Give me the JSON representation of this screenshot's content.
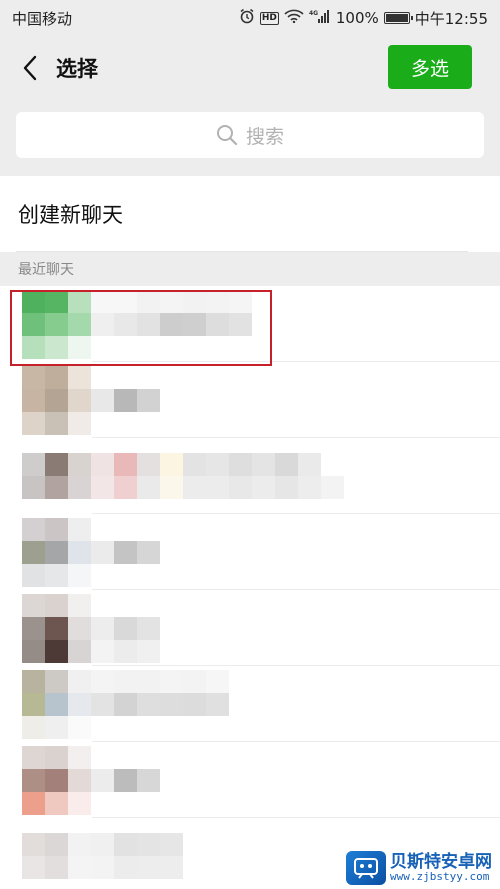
{
  "status_bar": {
    "carrier": "中国移动",
    "hd": "HD",
    "network": "4G",
    "battery": "100%",
    "time": "中午12:55",
    "icons": [
      "alarm-icon",
      "hd-icon",
      "wifi-icon",
      "signal-icon",
      "battery-icon"
    ]
  },
  "nav": {
    "back_icon": "chevron-left-icon",
    "title": "选择",
    "multi_select": "多选",
    "accent": "#1aad19"
  },
  "search": {
    "placeholder": "搜索",
    "icon": "search-icon"
  },
  "new_chat": {
    "label": "创建新聊天"
  },
  "recent": {
    "section_label": "最近聊天",
    "items": [
      {
        "mosaic": [
          [
            "#4fb05d",
            "#55b562",
            "#b8e0bd",
            "#f7f7f7",
            "#f7f7f7",
            "#f2f2f2",
            "#f4f4f4",
            "#f2f2f2",
            "#f3f3f3",
            "#f5f5f5"
          ],
          [
            "#6ec07a",
            "#86cc8f",
            "#a4d9ab",
            "#efefef",
            "#e8e8e8",
            "#e2e2e2",
            "#cdcdcd",
            "#cfcfcf",
            "#dddddd",
            "#e2e2e2"
          ],
          [
            "#b6dfbb",
            "#cbe8cf",
            "#eef7ef",
            "#ffffff",
            "#ffffff",
            "#ffffff",
            "#ffffff",
            "#ffffff",
            "#ffffff",
            "#ffffff"
          ]
        ]
      },
      {
        "mosaic": [
          [
            "#c9b7a5",
            "#bfae9c",
            "#ece3da",
            "#ffffff",
            "#ffffff",
            "#ffffff",
            "#ffffff",
            "#ffffff",
            "#ffffff",
            "#ffffff"
          ],
          [
            "#c8b4a2",
            "#b3a493",
            "#e1d6cc",
            "#e8e8e8",
            "#b8b8b8",
            "#d2d2d2",
            "#ffffff",
            "#ffffff",
            "#ffffff",
            "#ffffff"
          ],
          [
            "#ddd3c9",
            "#c9c0b6",
            "#f0ebe6",
            "#ffffff",
            "#ffffff",
            "#ffffff",
            "#ffffff",
            "#ffffff",
            "#ffffff",
            "#ffffff"
          ]
        ]
      },
      {
        "mosaic": [
          [
            "#cfcccc",
            "#8a7c75",
            "#d9d3d0",
            "#f0e3e3",
            "#e9b9b9",
            "#e4e0e0",
            "#fbf5e1",
            "#e3e3e3",
            "#e6e6e6",
            "#dedede",
            "#e4e4e4",
            "#d9d9d9",
            "#eaeaea",
            "#ffffff",
            "#ffffff",
            "#ffffff"
          ],
          [
            "#c8c4c3",
            "#b0a3a0",
            "#dad3d3",
            "#f3e6e6",
            "#efcfcf",
            "#eaeaea",
            "#fbf7ea",
            "#ececec",
            "#ececec",
            "#e8e8e8",
            "#ececec",
            "#e6e6e6",
            "#ededed",
            "#f3f3f3",
            "#ffffff",
            "#ffffff"
          ]
        ]
      },
      {
        "mosaic": [
          [
            "#d4cfd0",
            "#cbc5c6",
            "#eeeeee",
            "#ffffff",
            "#ffffff",
            "#ffffff",
            "#ffffff",
            "#ffffff",
            "#ffffff",
            "#ffffff"
          ],
          [
            "#9ea08f",
            "#a4a6a8",
            "#dfe4ea",
            "#ebebeb",
            "#c4c4c4",
            "#d6d6d6",
            "#ffffff",
            "#ffffff",
            "#ffffff",
            "#ffffff"
          ],
          [
            "#e1e2e3",
            "#e6e7e9",
            "#f5f6f7",
            "#ffffff",
            "#ffffff",
            "#ffffff",
            "#ffffff",
            "#ffffff",
            "#ffffff",
            "#ffffff"
          ]
        ]
      },
      {
        "mosaic": [
          [
            "#dcd7d4",
            "#d9d2cf",
            "#f2f0ef",
            "#ffffff",
            "#ffffff",
            "#ffffff",
            "#ffffff",
            "#ffffff",
            "#ffffff",
            "#ffffff"
          ],
          [
            "#9b928d",
            "#6d5550",
            "#e0dddc",
            "#ededed",
            "#d9d9d9",
            "#e3e3e3",
            "#ffffff",
            "#ffffff",
            "#ffffff",
            "#ffffff"
          ],
          [
            "#958c88",
            "#4d3a37",
            "#d8d4d3",
            "#f3f3f3",
            "#ececec",
            "#f0f0f0",
            "#ffffff",
            "#ffffff",
            "#ffffff",
            "#ffffff"
          ]
        ]
      },
      {
        "mosaic": [
          [
            "#b7b39e",
            "#cdcac6",
            "#f0f0f0",
            "#f4f4f4",
            "#f2f2f2",
            "#f2f2f2",
            "#f4f4f4",
            "#f3f3f3",
            "#f6f6f6",
            "#ffffff"
          ],
          [
            "#b7b995",
            "#b7c4ce",
            "#e5e9ed",
            "#e3e3e3",
            "#d3d3d3",
            "#dedede",
            "#dddddd",
            "#dcdcdc",
            "#e0e0e0",
            "#ffffff"
          ],
          [
            "#eeede8",
            "#efeff0",
            "#fafafa",
            "#ffffff",
            "#ffffff",
            "#ffffff",
            "#ffffff",
            "#ffffff",
            "#ffffff",
            "#ffffff"
          ]
        ]
      },
      {
        "mosaic": [
          [
            "#ddd6d3",
            "#dad2cf",
            "#f2efee",
            "#ffffff",
            "#ffffff",
            "#ffffff",
            "#ffffff",
            "#ffffff",
            "#ffffff",
            "#ffffff"
          ],
          [
            "#ad8f86",
            "#a3807a",
            "#e3d9d7",
            "#ececec",
            "#bcbcbc",
            "#d7d7d7",
            "#ffffff",
            "#ffffff",
            "#ffffff",
            "#ffffff"
          ],
          [
            "#ec9f8b",
            "#efc9bf",
            "#f9ecea",
            "#ffffff",
            "#ffffff",
            "#ffffff",
            "#ffffff",
            "#ffffff",
            "#ffffff",
            "#ffffff"
          ]
        ]
      },
      {
        "mosaic": [
          [
            "#e2dcdb",
            "#dcd7d7",
            "#f3f2f2",
            "#f0f0f0",
            "#e2e2e2",
            "#e4e4e4",
            "#e6e6e6",
            "#ffffff",
            "#ffffff",
            "#ffffff"
          ],
          [
            "#e9e5e4",
            "#e2dede",
            "#f5f4f4",
            "#f3f3f3",
            "#ececec",
            "#ededed",
            "#ededed",
            "#ffffff",
            "#ffffff",
            "#ffffff"
          ]
        ]
      }
    ]
  },
  "highlight_color": "#c6202a",
  "watermark": {
    "title": "贝斯特安卓网",
    "url": "www.zjbstyy.com"
  }
}
